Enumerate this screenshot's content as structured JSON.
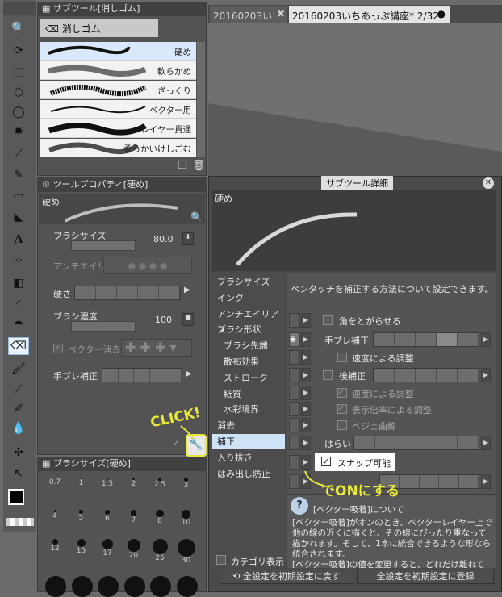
{
  "tabs": {
    "tab1": "20160203い",
    "tab2": "20160203いちあっぷ講座* 2/32"
  },
  "subtool_panel": {
    "title": "サブツール[消しゴム]",
    "group": "消しゴム",
    "brushes": [
      "硬め",
      "軟らかめ",
      "ざっくり",
      "ベクター用",
      "レイヤー貫通",
      "柔らかいけしごむ"
    ]
  },
  "tool_property": {
    "title": "ツールプロパティ[硬め]",
    "preset": "硬め",
    "brush_size_label": "ブラシサイズ",
    "brush_size_value": "80.0",
    "antialias_label": "アンチエイリ",
    "hardness_label": "硬さ",
    "density_label": "ブラシ濃度",
    "density_value": "100",
    "vector_erase_label": "ベクター消去",
    "stabilize_label": "手ブレ補正"
  },
  "brush_size_panel": {
    "title": "ブラシサイズ[硬め]",
    "row1": [
      "0.7",
      "1",
      "1.5",
      "2",
      "2.5",
      "3"
    ],
    "row2": [
      "4",
      "5",
      "6",
      "7",
      "8",
      "10"
    ],
    "row3": [
      "12",
      "15",
      "17",
      "20",
      "25",
      "30"
    ]
  },
  "detail_dialog": {
    "title": "サブツール詳細",
    "preset": "硬め",
    "categories": [
      "ブラシサイズ",
      "インク",
      "アンチエイリアス",
      "ブラシ形状",
      "ブラシ先端",
      "散布効果",
      "ストローク",
      "紙質",
      "水彩境界",
      "消去",
      "補正",
      "入り抜き",
      "はみ出し防止"
    ],
    "description": "ペンタッチを補正する方法について設定できます。",
    "opt_corner": "角をとがらせる",
    "opt_stabilize": "手ブレ補正",
    "opt_speed": "速度による調整",
    "opt_post": "後補正",
    "opt_post_speed": "速度による調整",
    "opt_zoom": "表示倍率による調整",
    "opt_bezier": "ベジェ曲線",
    "opt_harai": "はらい",
    "opt_snap": "スナップ可能",
    "help_title": "[ベクター吸着]について",
    "help_text": "[ベクター吸着]がオンのとき、ベクターレイヤー上で他の線の近くに描くと、その線にぴったり重なって描かれます。そして、1本に統合できるような形なら統合されます。",
    "help_text2": "[ベクター吸着]の値を変更すると、どれだけ離れて",
    "show_category": "カテゴリ表示",
    "reset_button": "全設定を初期設定に戻す",
    "register_button": "全設定を初期設定に登録"
  },
  "annotations": {
    "click": "CLICK!",
    "on": "でONにする"
  }
}
